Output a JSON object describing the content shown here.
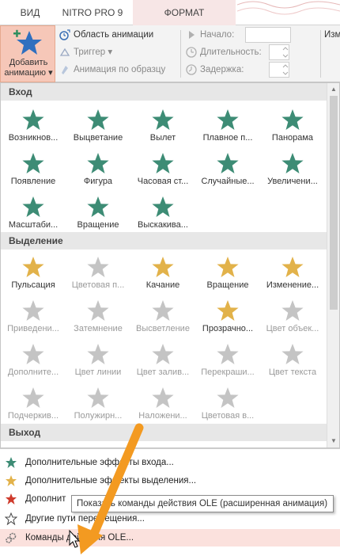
{
  "tabs": [
    {
      "label": "ВИД"
    },
    {
      "label": "NITRO PRO 9"
    },
    {
      "label": "ФОРМАТ"
    }
  ],
  "ribbon": {
    "add_animation": {
      "line1": "Добавить",
      "line2": "анимацию ▾"
    },
    "animation_pane": "Область анимации",
    "trigger": "Триггер ▾",
    "painter": "Анимация по образцу",
    "start": "Начало:",
    "duration": "Длительность:",
    "delay": "Задержка:",
    "reorder": "Изм"
  },
  "gallery": {
    "sections": [
      "Вход",
      "Выделение",
      "Выход"
    ],
    "entrance": [
      "Возникнов...",
      "Выцветание",
      "Вылет",
      "Плавное п...",
      "Панорама",
      "Появление",
      "Фигура",
      "Часовая ст...",
      "Случайные...",
      "Увеличени...",
      "Масштаби...",
      "Вращение",
      "Выскакива..."
    ],
    "emphasis": [
      "Пульсация",
      "Цветовая п...",
      "Качание",
      "Вращение",
      "Изменение...",
      "Приведени...",
      "Затемнение",
      "Высветление",
      "Прозрачно...",
      "Цвет объек...",
      "Дополните...",
      "Цвет линии",
      "Цвет залив...",
      "Перекраши...",
      "Цвет текста",
      "Подчеркив...",
      "Полужирн...",
      "Наложени...",
      "Цветовая в..."
    ]
  },
  "menu": [
    {
      "label": "Дополнительные эффекты входа..."
    },
    {
      "label": "Дополнительные эффекты выделения..."
    },
    {
      "label": "Дополнит"
    },
    {
      "label": "Другие пути перемещения..."
    },
    {
      "label": "Команды действия OLE..."
    }
  ],
  "tooltip": "Показать команды действия OLE (расширенная анимация)",
  "colors": {
    "green_star": "#3d8c75",
    "gold_star": "#e2b24a",
    "red_star": "#cf3b2c",
    "gray_star": "#c4c4c4",
    "accent": "#f6c7b8",
    "arrow": "#f39a21"
  }
}
